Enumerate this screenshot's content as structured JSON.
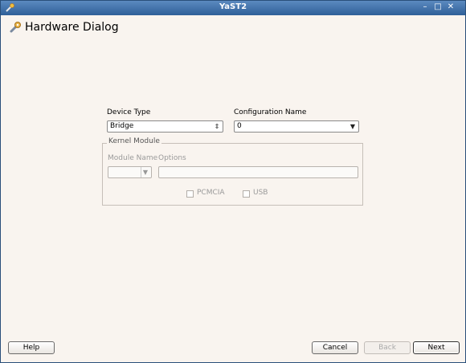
{
  "window": {
    "title": "YaST2"
  },
  "header": {
    "title": "Hardware Dialog",
    "icon": "wrench-icon"
  },
  "form": {
    "device_type": {
      "label": "Device Type",
      "value": "Bridge"
    },
    "configuration_name": {
      "label": "Configuration Name",
      "value": "0"
    },
    "kernel_module": {
      "legend": "Kernel Module",
      "module_name_label": "Module Name",
      "module_name_value": "",
      "options_label": "Options",
      "options_value": "",
      "pcmcia_label": "PCMCIA",
      "usb_label": "USB"
    }
  },
  "buttons": {
    "help": "Help",
    "cancel": "Cancel",
    "back": "Back",
    "next": "Next"
  }
}
